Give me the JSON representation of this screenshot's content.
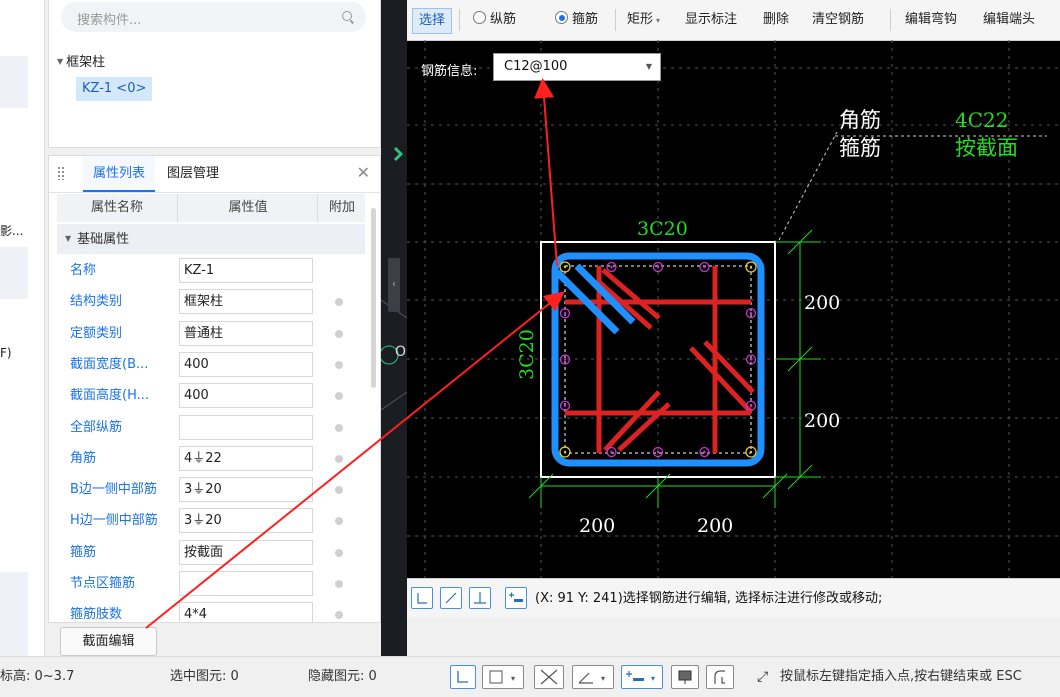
{
  "left_strip": {
    "text_1": "影...",
    "text_2": "F)"
  },
  "tree": {
    "search_placeholder": "搜索构件...",
    "group_label": "框架柱",
    "selected_item": "KZ-1 <0>"
  },
  "property_panel": {
    "tabs": [
      "属性列表",
      "图层管理"
    ],
    "columns": {
      "name": "属性名称",
      "value": "属性值",
      "extra": "附加"
    },
    "section": "基础属性",
    "rows": [
      {
        "name": "名称",
        "value": "KZ-1"
      },
      {
        "name": "结构类别",
        "value": "框架柱"
      },
      {
        "name": "定额类别",
        "value": "普通柱"
      },
      {
        "name": "截面宽度(B...",
        "value": "400"
      },
      {
        "name": "截面高度(H...",
        "value": "400"
      },
      {
        "name": "全部纵筋",
        "value": ""
      },
      {
        "name": "角筋",
        "value": "4⏚22"
      },
      {
        "name": "B边一侧中部筋",
        "value": "3⏚20"
      },
      {
        "name": "H边一侧中部筋",
        "value": "3⏚20"
      },
      {
        "name": "箍筋",
        "value": "按截面"
      },
      {
        "name": "节点区箍筋",
        "value": ""
      },
      {
        "name": "箍筋肢数",
        "value": "4*4"
      }
    ],
    "section_edit_button": "截面编辑"
  },
  "toolbar": {
    "select": "选择",
    "longitudinal": "纵筋",
    "stirrup": "箍筋",
    "shape": "矩形",
    "show_labels": "显示标注",
    "delete": "删除",
    "clear_rebar": "清空钢筋",
    "edit_hook": "编辑弯钩",
    "edit_end": "编辑端头"
  },
  "rebar_info": {
    "label": "钢筋信息:",
    "value": "C12@100"
  },
  "canvas_labels": {
    "corner_label": "角筋",
    "corner_value": "4C22",
    "stirrup_label": "箍筋",
    "stirrup_value": "按截面",
    "top_rebar": "3C20",
    "left_rebar": "3C20",
    "dim_right_top": "200",
    "dim_right_bottom": "200",
    "dim_bottom_left": "200",
    "dim_bottom_right": "200",
    "side_glyph_1": "<",
    "side_glyph_2": "O"
  },
  "editor_status": "(X: 91 Y: 241)选择钢筋进行编辑, 选择标注进行修改或移动;",
  "bottom_bar": {
    "elevation": "标高:  0~3.7",
    "selected": "选中图元:  0",
    "hidden": "隐藏图元:  0",
    "hint": "按鼠标左键指定插入点,按右键结束或 ESC"
  },
  "colors": {
    "accent": "#1a73e8",
    "canvas_bg": "#000000",
    "dim_green": "#22dd22",
    "stirrup_blue": "#1e90ff",
    "rebar_red": "#dd2222",
    "arrow_red": "#ff2020"
  }
}
